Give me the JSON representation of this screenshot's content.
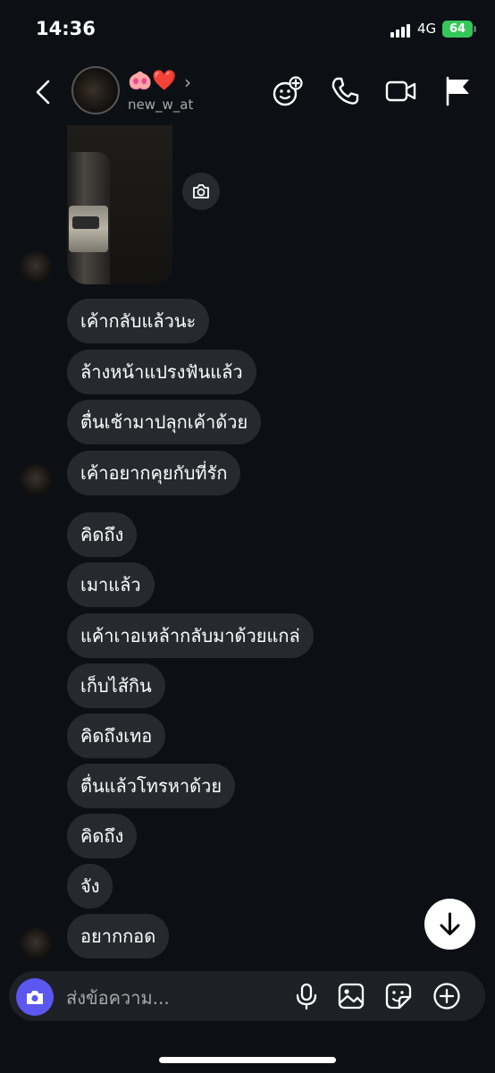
{
  "status_bar": {
    "time": "14:36",
    "network": "4G",
    "battery": "64"
  },
  "header": {
    "display_name": "🐽❤️",
    "username": "new_w_at",
    "icons": [
      "back-arrow-icon",
      "chevron-right-icon",
      "effects-icon",
      "phone-icon",
      "video-camera-icon",
      "flag-icon"
    ]
  },
  "messages": [
    {
      "text": "เค้ากลับแล้วนะ"
    },
    {
      "text": "ล้างหน้าแปรงฟันแล้ว"
    },
    {
      "text": "ตื่นเช้ามาปลุกเค้าด้วย"
    },
    {
      "text": "เค้าอยากคุยกับที่รัก"
    },
    {
      "text": "คิดถึง"
    },
    {
      "text": "เมาแล้ว"
    },
    {
      "text": "แค้าเาอเหล้ากลับมาด้วยแกล่"
    },
    {
      "text": "เก็บไส้กิน"
    },
    {
      "text": "คิดถึงเทอ"
    },
    {
      "text": "ตื่นแล้วโทรหาด้วย"
    },
    {
      "text": "คิดถึง"
    },
    {
      "text": "จัง"
    },
    {
      "text": "อยากกอด"
    }
  ],
  "composer": {
    "placeholder": "ส่งข้อความ...",
    "icons": [
      "camera-icon",
      "microphone-icon",
      "gallery-icon",
      "sticker-icon",
      "plus-icon"
    ]
  },
  "colors": {
    "background": "#0c1014",
    "bubble": "#262a2f",
    "accent": "#5b57f0",
    "battery": "#34c759"
  }
}
